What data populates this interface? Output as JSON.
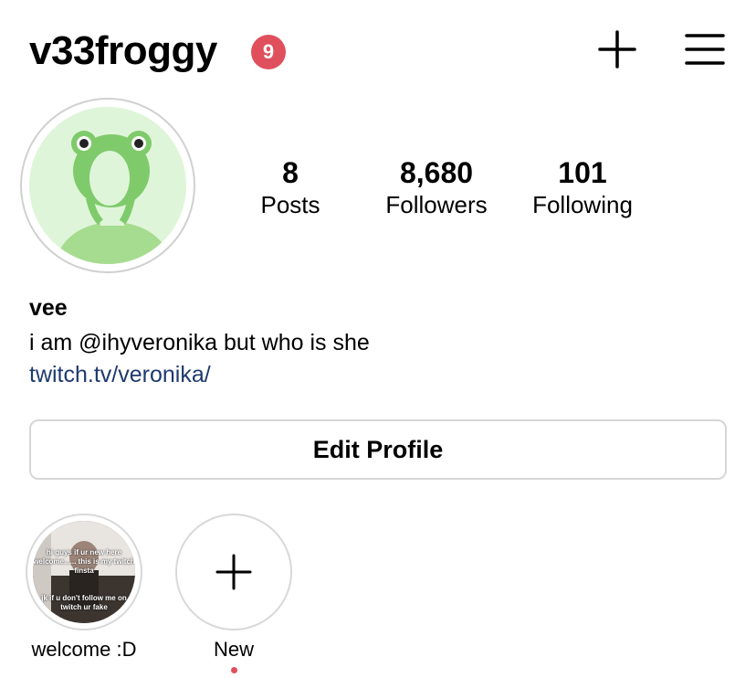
{
  "header": {
    "username": "v33froggy",
    "notification_count": "9"
  },
  "stats": {
    "posts": {
      "value": "8",
      "label": "Posts"
    },
    "followers": {
      "value": "8,680",
      "label": "Followers"
    },
    "following": {
      "value": "101",
      "label": "Following"
    }
  },
  "bio": {
    "name": "vee",
    "text": "i am @ihyveronika but who is she",
    "link": "twitch.tv/veronika/"
  },
  "actions": {
    "edit_profile": "Edit Profile"
  },
  "highlights": [
    {
      "label": "welcome :D",
      "thumb_text_top": "hi guys if ur new here welcome...... this is my twitch finsta",
      "thumb_text_bottom": "jk if u don't follow me on twitch ur fake"
    },
    {
      "label": "New"
    }
  ],
  "colors": {
    "badge": "#e0505c",
    "link": "#1e3a6e",
    "avatar_bg": "#dff5d9",
    "frog_green": "#7fcb6b"
  },
  "icons": {
    "create": "plus-icon",
    "menu": "hamburger-menu-icon",
    "new_highlight": "plus-icon"
  }
}
